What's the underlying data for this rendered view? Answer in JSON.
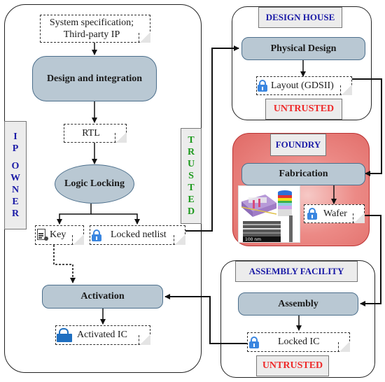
{
  "ip_owner": {
    "side_label_letters": [
      "I",
      "P",
      "",
      "O",
      "W",
      "N",
      "E",
      "R"
    ],
    "trust_label_letters": [
      "T",
      "R",
      "U",
      "S",
      "T",
      "E",
      "D"
    ],
    "spec_doc": {
      "line1": "System specification;",
      "line2": "Third-party IP"
    },
    "design_integration": "Design and integration",
    "rtl": "RTL",
    "logic_locking": "Logic Locking",
    "key": "Key",
    "locked_netlist": "Locked netlist",
    "activation": "Activation",
    "activated_ic": "Activated IC"
  },
  "design_house": {
    "title": "DESIGN HOUSE",
    "physical_design": "Physical Design",
    "layout": "Layout (GDSII)",
    "trust": "UNTRUSTED"
  },
  "foundry": {
    "title": "FOUNDRY",
    "fabrication": "Fabrication",
    "wafer": "Wafer",
    "image_scale_label": "100 nm"
  },
  "assembly": {
    "title": "ASSEMBLY FACILITY",
    "assembly": "Assembly",
    "locked_ic": "Locked IC",
    "trust": "UNTRUSTED"
  },
  "colors": {
    "process_fill": "#b9c8d3",
    "title_blue": "#1a1aa6",
    "untrusted_red": "#ee2a2a",
    "trusted_green": "#1e9a1e",
    "foundry_red": "#e06a66",
    "lock_blue": "#3a86e0"
  }
}
